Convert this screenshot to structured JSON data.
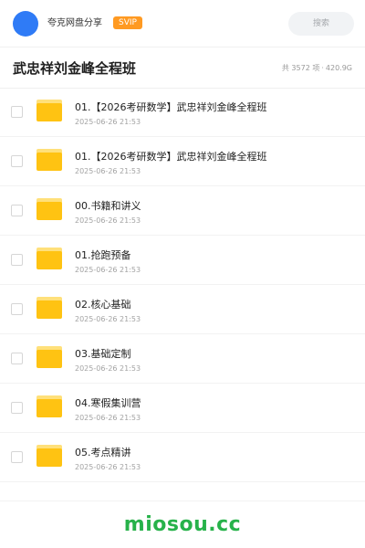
{
  "header": {
    "brand_name": "夸克网盘分享",
    "svip_badge": "SVIP",
    "search_label": "搜索"
  },
  "title_bar": {
    "title": "武忠祥刘金峰全程班",
    "item_count": "共 3572 项",
    "separator": "·",
    "total_size": "420.9G"
  },
  "files": [
    {
      "name": "01.【2026考研数学】武忠祥刘金峰全程班",
      "date": "2025-06-26 21:53",
      "icon": "folder-icon"
    },
    {
      "name": "01.【2026考研数学】武忠祥刘金峰全程班",
      "date": "2025-06-26 21:53",
      "icon": "folder-icon"
    },
    {
      "name": "00.书籍和讲义",
      "date": "2025-06-26 21:53",
      "icon": "folder-icon"
    },
    {
      "name": "01.抢跑预备",
      "date": "2025-06-26 21:53",
      "icon": "folder-icon"
    },
    {
      "name": "02.核心基础",
      "date": "2025-06-26 21:53",
      "icon": "folder-icon"
    },
    {
      "name": "03.基础定制",
      "date": "2025-06-26 21:53",
      "icon": "folder-icon"
    },
    {
      "name": "04.寒假集训营",
      "date": "2025-06-26 21:53",
      "icon": "folder-icon"
    },
    {
      "name": "05.考点精讲",
      "date": "2025-06-26 21:53",
      "icon": "folder-icon"
    }
  ],
  "footer": {
    "watermark": "miosou.cc"
  },
  "colors": {
    "avatar": "#2f7bf6",
    "svip_badge": "#ff9a22",
    "folder": "#ffc312",
    "watermark": "#27b24a"
  }
}
